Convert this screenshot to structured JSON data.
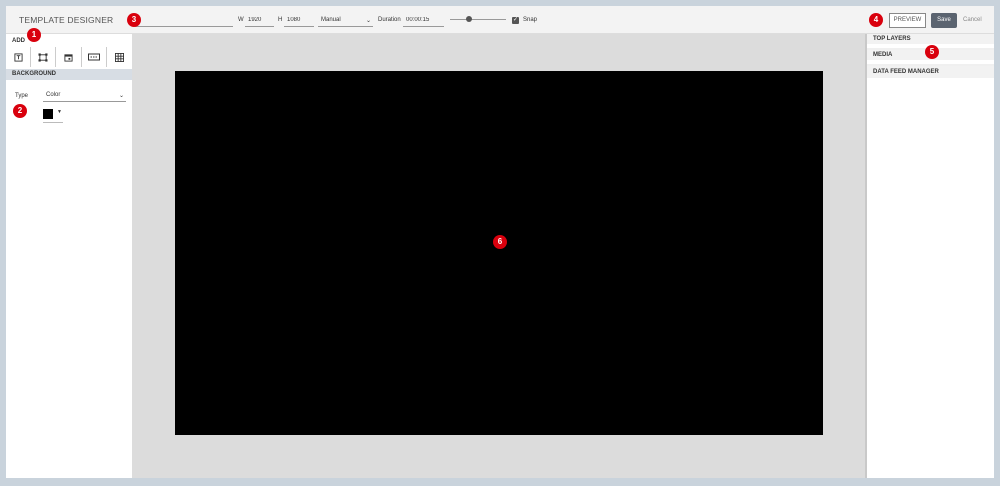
{
  "header": {
    "title": "TEMPLATE DESIGNER",
    "name_value": "",
    "width_label": "W",
    "width_value": "1920",
    "height_label": "H",
    "height_value": "1080",
    "mode_value": "Manual",
    "duration_label": "Duration",
    "duration_value": "00:00:15",
    "snap_checked": true,
    "snap_label": "Snap",
    "preview_label": "PREVIEW",
    "save_label": "Save",
    "cancel_label": "Cancel"
  },
  "left_panel": {
    "add_label": "ADD",
    "tools": [
      "text-tool-icon",
      "shape-tool-icon",
      "date-tool-icon",
      "ticker-tool-icon",
      "table-tool-icon"
    ],
    "background_header": "BACKGROUND",
    "type_label": "Type",
    "type_value": "Color",
    "background_color": "#000000"
  },
  "right_panel": {
    "top_layers": "TOP LAYERS",
    "media": "MEDIA",
    "data_feed_manager": "DATA FEED MANAGER"
  },
  "annotations": {
    "b1": "1",
    "b2": "2",
    "b3": "3",
    "b4": "4",
    "b5": "5",
    "b6": "6"
  },
  "colors": {
    "canvas": "#000000",
    "save_button": "#5b6470",
    "badge": "#d9000d",
    "section_header": "#d7dde4"
  }
}
